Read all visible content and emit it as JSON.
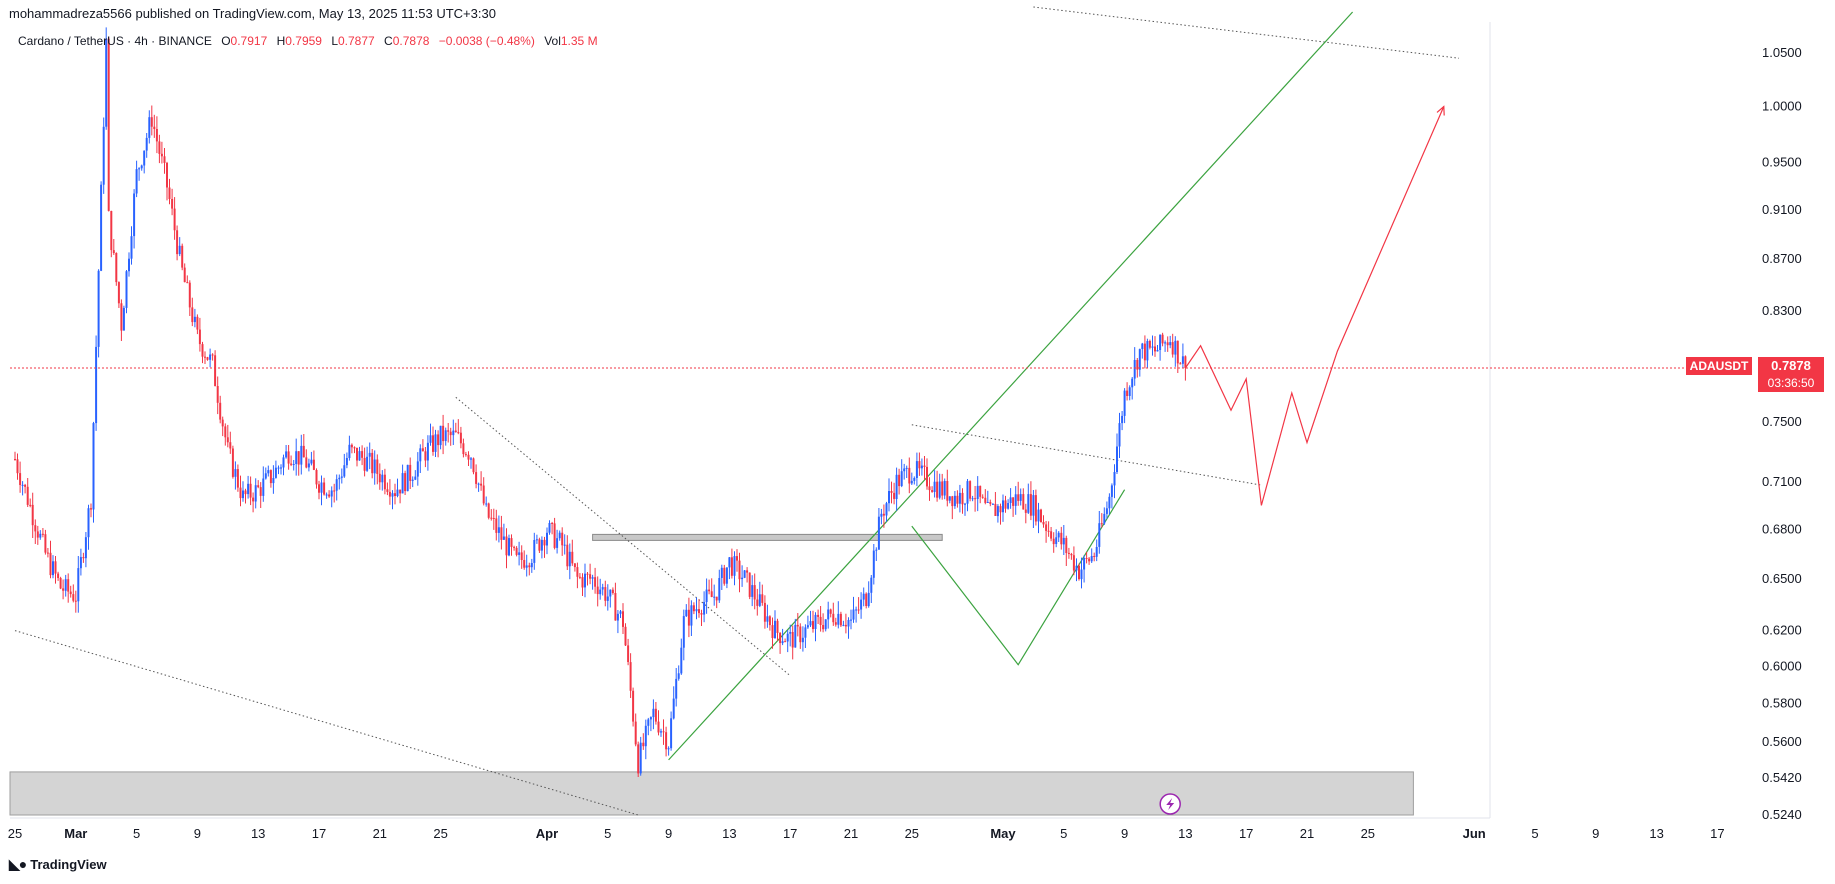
{
  "header": {
    "publisher": "mohammadreza5566 published on TradingView.com, May 13, 2025 11:53 UTC+3:30"
  },
  "legend": {
    "symbol": "Cardano / TetherUS · 4h · BINANCE",
    "o_label": "O",
    "o_value": "0.7917",
    "h_label": "H",
    "h_value": "0.7959",
    "l_label": "L",
    "l_value": "0.7877",
    "c_label": "C",
    "c_value": "0.7878",
    "change": "−0.0038 (−0.48%)",
    "vol_label": "Vol",
    "vol_value": "1.35 M"
  },
  "price_badge": {
    "symbol": "ADAUSDT",
    "price": "0.7878",
    "countdown": "03:36:50"
  },
  "footer": {
    "brand": "TradingView"
  },
  "colors": {
    "up": "#2962ff",
    "down": "#f23645",
    "projection": "#f23645",
    "green_line": "#3ca340",
    "zone": "#cfcfcf"
  },
  "chart_data": {
    "type": "candlestick",
    "title": "",
    "y_scale": "log",
    "y_ticks": [
      1.05,
      1.0,
      0.95,
      0.91,
      0.87,
      0.83,
      0.75,
      0.71,
      0.68,
      0.65,
      0.62,
      0.6,
      0.58,
      0.56,
      0.542,
      0.524
    ],
    "y_tick_labels": [
      "1.0500",
      "1.0000",
      "0.9500",
      "0.9100",
      "0.8700",
      "0.8300",
      "0.7500",
      "0.7100",
      "0.6800",
      "0.6500",
      "0.6200",
      "0.6000",
      "0.5800",
      "0.5600",
      "0.5420",
      "0.5240"
    ],
    "x_ticks": [
      {
        "label": "25",
        "date": "2025-02-25"
      },
      {
        "label": "Mar",
        "date": "2025-03-01"
      },
      {
        "label": "5",
        "date": "2025-03-05"
      },
      {
        "label": "9",
        "date": "2025-03-09"
      },
      {
        "label": "13",
        "date": "2025-03-13"
      },
      {
        "label": "17",
        "date": "2025-03-17"
      },
      {
        "label": "21",
        "date": "2025-03-21"
      },
      {
        "label": "25",
        "date": "2025-03-25"
      },
      {
        "label": "Apr",
        "date": "2025-04-01"
      },
      {
        "label": "5",
        "date": "2025-04-05"
      },
      {
        "label": "9",
        "date": "2025-04-09"
      },
      {
        "label": "13",
        "date": "2025-04-13"
      },
      {
        "label": "17",
        "date": "2025-04-17"
      },
      {
        "label": "21",
        "date": "2025-04-21"
      },
      {
        "label": "25",
        "date": "2025-04-25"
      },
      {
        "label": "May",
        "date": "2025-05-01"
      },
      {
        "label": "5",
        "date": "2025-05-05"
      },
      {
        "label": "9",
        "date": "2025-05-09"
      },
      {
        "label": "13",
        "date": "2025-05-13"
      },
      {
        "label": "17",
        "date": "2025-05-17"
      },
      {
        "label": "21",
        "date": "2025-05-21"
      },
      {
        "label": "25",
        "date": "2025-05-25"
      },
      {
        "label": "Jun",
        "date": "2025-06-01"
      },
      {
        "label": "5",
        "date": "2025-06-05"
      },
      {
        "label": "9",
        "date": "2025-06-09"
      },
      {
        "label": "13",
        "date": "2025-06-13"
      },
      {
        "label": "17",
        "date": "2025-06-17"
      }
    ],
    "price_path": [
      [
        "2025-02-25",
        0.725
      ],
      [
        "2025-02-27",
        0.665
      ],
      [
        "2025-02-28",
        0.645
      ],
      [
        "2025-03-01",
        0.64
      ],
      [
        "2025-03-02",
        0.7
      ],
      [
        "2025-03-03",
        1.06
      ],
      [
        "2025-03-03",
        0.92
      ],
      [
        "2025-03-04",
        0.82
      ],
      [
        "2025-03-05",
        0.94
      ],
      [
        "2025-03-06",
        0.99
      ],
      [
        "2025-03-07",
        0.93
      ],
      [
        "2025-03-08",
        0.86
      ],
      [
        "2025-03-09",
        0.81
      ],
      [
        "2025-03-10",
        0.79
      ],
      [
        "2025-03-11",
        0.73
      ],
      [
        "2025-03-12",
        0.7
      ],
      [
        "2025-03-13",
        0.705
      ],
      [
        "2025-03-14",
        0.715
      ],
      [
        "2025-03-15",
        0.73
      ],
      [
        "2025-03-16",
        0.725
      ],
      [
        "2025-03-17",
        0.71
      ],
      [
        "2025-03-18",
        0.705
      ],
      [
        "2025-03-19",
        0.73
      ],
      [
        "2025-03-20",
        0.725
      ],
      [
        "2025-03-21",
        0.715
      ],
      [
        "2025-03-22",
        0.705
      ],
      [
        "2025-03-23",
        0.715
      ],
      [
        "2025-03-24",
        0.73
      ],
      [
        "2025-03-25",
        0.74
      ],
      [
        "2025-03-26",
        0.74
      ],
      [
        "2025-03-27",
        0.728
      ],
      [
        "2025-03-28",
        0.69
      ],
      [
        "2025-03-29",
        0.675
      ],
      [
        "2025-03-30",
        0.66
      ],
      [
        "2025-03-31",
        0.665
      ],
      [
        "2025-04-01",
        0.68
      ],
      [
        "2025-04-02",
        0.67
      ],
      [
        "2025-04-03",
        0.65
      ],
      [
        "2025-04-04",
        0.65
      ],
      [
        "2025-04-05",
        0.64
      ],
      [
        "2025-04-06",
        0.625
      ],
      [
        "2025-04-07",
        0.55
      ],
      [
        "2025-04-08",
        0.575
      ],
      [
        "2025-04-09",
        0.56
      ],
      [
        "2025-04-10",
        0.625
      ],
      [
        "2025-04-11",
        0.635
      ],
      [
        "2025-04-12",
        0.64
      ],
      [
        "2025-04-13",
        0.66
      ],
      [
        "2025-04-14",
        0.65
      ],
      [
        "2025-04-15",
        0.635
      ],
      [
        "2025-04-16",
        0.62
      ],
      [
        "2025-04-17",
        0.615
      ],
      [
        "2025-04-18",
        0.62
      ],
      [
        "2025-04-19",
        0.625
      ],
      [
        "2025-04-20",
        0.63
      ],
      [
        "2025-04-21",
        0.625
      ],
      [
        "2025-04-22",
        0.64
      ],
      [
        "2025-04-23",
        0.69
      ],
      [
        "2025-04-24",
        0.71
      ],
      [
        "2025-04-25",
        0.718
      ],
      [
        "2025-04-26",
        0.712
      ],
      [
        "2025-04-27",
        0.705
      ],
      [
        "2025-04-28",
        0.7
      ],
      [
        "2025-04-29",
        0.705
      ],
      [
        "2025-04-30",
        0.69
      ],
      [
        "2025-05-01",
        0.695
      ],
      [
        "2025-05-02",
        0.7
      ],
      [
        "2025-05-03",
        0.695
      ],
      [
        "2025-05-04",
        0.68
      ],
      [
        "2025-05-05",
        0.67
      ],
      [
        "2025-05-06",
        0.655
      ],
      [
        "2025-05-07",
        0.665
      ],
      [
        "2025-05-08",
        0.7
      ],
      [
        "2025-05-09",
        0.77
      ],
      [
        "2025-05-10",
        0.8
      ],
      [
        "2025-05-11",
        0.8
      ],
      [
        "2025-05-12",
        0.81
      ],
      [
        "2025-05-13",
        0.7878
      ]
    ],
    "resistance_zone": {
      "from": "2025-04-04",
      "to": "2025-04-27",
      "low": 0.672,
      "high": 0.675
    },
    "support_zone": {
      "from": "2025-02-25",
      "to": "2025-05-28",
      "low": 0.524,
      "high": 0.545
    },
    "current_price_line": 0.7878,
    "trend_lines": [
      {
        "style": "dotted",
        "points": [
          [
            "2025-02-25",
            0.62
          ],
          [
            "2025-04-07",
            0.524
          ]
        ]
      },
      {
        "style": "dotted",
        "points": [
          [
            "2025-03-26",
            0.767
          ],
          [
            "2025-04-17",
            0.595
          ]
        ]
      },
      {
        "style": "dotted",
        "points": [
          [
            "2025-04-25",
            0.748
          ],
          [
            "2025-05-18",
            0.708
          ]
        ]
      },
      {
        "style": "dotted",
        "points": [
          [
            "2025-05-03",
            1.095
          ],
          [
            "2025-05-31",
            1.045
          ]
        ]
      },
      {
        "style": "solid",
        "color": "green",
        "points": [
          [
            "2025-04-09",
            0.551
          ],
          [
            "2025-05-24",
            1.09
          ]
        ]
      },
      {
        "style": "solid",
        "color": "green",
        "points": [
          [
            "2025-04-25",
            0.682
          ],
          [
            "2025-05-02",
            0.601
          ],
          [
            "2025-05-09",
            0.705
          ]
        ]
      }
    ],
    "projection_path": [
      [
        "2025-05-14",
        0.804
      ],
      [
        "2025-05-16",
        0.758
      ],
      [
        "2025-05-17",
        0.78
      ],
      [
        "2025-05-18",
        0.695
      ],
      [
        "2025-05-20",
        0.77
      ],
      [
        "2025-05-21",
        0.736
      ],
      [
        "2025-05-23",
        0.8
      ],
      [
        "2025-05-30",
        1.0
      ]
    ]
  }
}
